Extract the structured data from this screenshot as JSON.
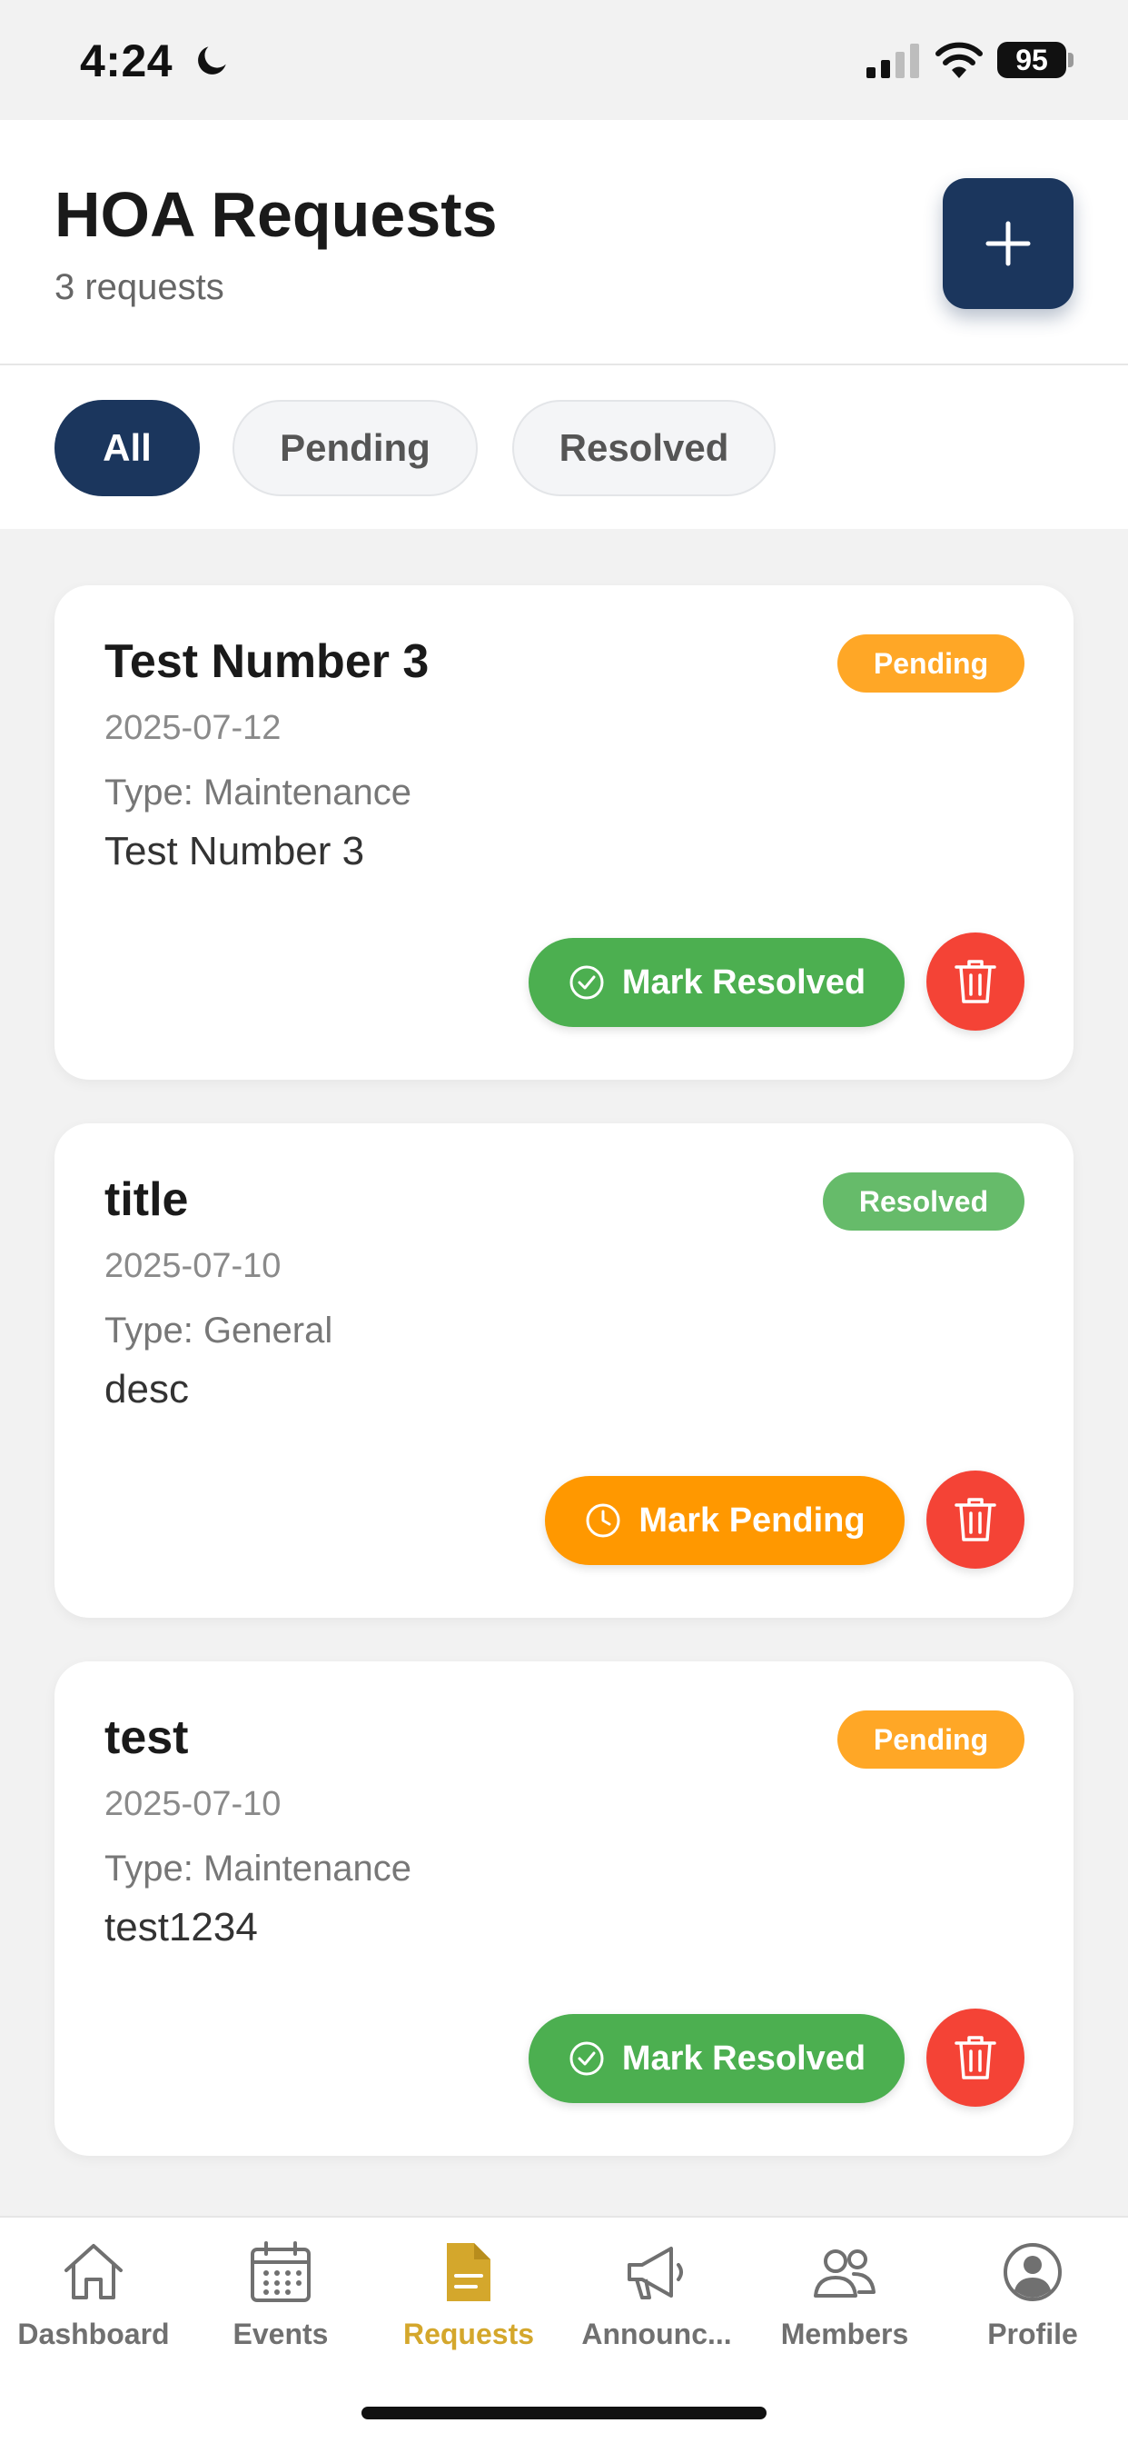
{
  "status_bar": {
    "time": "4:24",
    "battery": "95"
  },
  "header": {
    "title": "HOA Requests",
    "subtitle": "3 requests"
  },
  "filters": [
    {
      "label": "All",
      "active": true
    },
    {
      "label": "Pending",
      "active": false
    },
    {
      "label": "Resolved",
      "active": false
    }
  ],
  "requests": [
    {
      "title": "Test Number 3",
      "status": "Pending",
      "date": "2025-07-12",
      "type": "Type: Maintenance",
      "description": "Test Number 3",
      "action_label": "Mark Resolved"
    },
    {
      "title": "title",
      "status": "Resolved",
      "date": "2025-07-10",
      "type": "Type: General",
      "description": "desc",
      "action_label": "Mark Pending"
    },
    {
      "title": "test",
      "status": "Pending",
      "date": "2025-07-10",
      "type": "Type: Maintenance",
      "description": "test1234",
      "action_label": "Mark Resolved"
    }
  ],
  "nav": [
    {
      "label": "Dashboard",
      "icon": "home-icon",
      "active": false
    },
    {
      "label": "Events",
      "icon": "calendar-icon",
      "active": false
    },
    {
      "label": "Requests",
      "icon": "document-icon",
      "active": true
    },
    {
      "label": "Announc...",
      "icon": "megaphone-icon",
      "active": false
    },
    {
      "label": "Members",
      "icon": "people-icon",
      "active": false
    },
    {
      "label": "Profile",
      "icon": "profile-icon",
      "active": false
    }
  ],
  "colors": {
    "primary": "#1b365d",
    "pending": "#ffa726",
    "resolved": "#66bb6a",
    "resolve_button": "#4caf50",
    "pending_button": "#ff9800",
    "delete": "#f44336",
    "nav_active": "#d4a72c"
  }
}
